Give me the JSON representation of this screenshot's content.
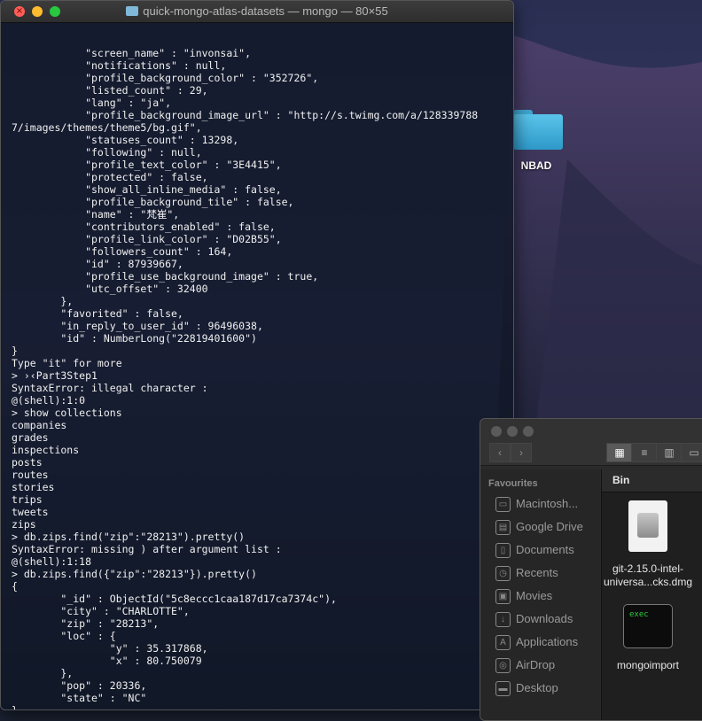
{
  "desktop": {
    "folder_label": "NBAD"
  },
  "terminal": {
    "title": "quick-mongo-atlas-datasets — mongo — 80×55",
    "lines": [
      "            \"screen_name\" : \"invonsai\",",
      "            \"notifications\" : null,",
      "            \"profile_background_color\" : \"352726\",",
      "            \"listed_count\" : 29,",
      "            \"lang\" : \"ja\",",
      "            \"profile_background_image_url\" : \"http://s.twimg.com/a/128339788",
      "7/images/themes/theme5/bg.gif\",",
      "            \"statuses_count\" : 13298,",
      "            \"following\" : null,",
      "            \"profile_text_color\" : \"3E4415\",",
      "            \"protected\" : false,",
      "            \"show_all_inline_media\" : false,",
      "            \"profile_background_tile\" : false,",
      "            \"name\" : \"梵崔\",",
      "            \"contributors_enabled\" : false,",
      "            \"profile_link_color\" : \"D02B55\",",
      "            \"followers_count\" : 164,",
      "            \"id\" : 87939667,",
      "            \"profile_use_background_image\" : true,",
      "            \"utc_offset\" : 32400",
      "        },",
      "        \"favorited\" : false,",
      "        \"in_reply_to_user_id\" : 96496038,",
      "        \"id\" : NumberLong(\"22819401600\")",
      "}",
      "Type \"it\" for more",
      "> ›‹Part3Step1",
      "SyntaxError: illegal character :",
      "@(shell):1:0",
      "> show collections",
      "companies",
      "grades",
      "inspections",
      "posts",
      "routes",
      "stories",
      "trips",
      "tweets",
      "zips",
      "> db.zips.find(\"zip\":\"28213\").pretty()",
      "SyntaxError: missing ) after argument list :",
      "@(shell):1:18",
      "> db.zips.find({\"zip\":\"28213\"}).pretty()",
      "{",
      "        \"_id\" : ObjectId(\"5c8eccc1caa187d17ca7374c\"),",
      "        \"city\" : \"CHARLOTTE\",",
      "        \"zip\" : \"28213\",",
      "        \"loc\" : {",
      "                \"y\" : 35.317868,",
      "                \"x\" : 80.750079",
      "        },",
      "        \"pop\" : 20336,",
      "        \"state\" : \"NC\"",
      "}"
    ],
    "prompt": "> "
  },
  "finder": {
    "sidebar_heading": "Favourites",
    "sidebar_items": [
      {
        "label": "Macintosh...",
        "icon": "harddisk-icon"
      },
      {
        "label": "Google Drive",
        "icon": "folder-icon"
      },
      {
        "label": "Documents",
        "icon": "document-icon"
      },
      {
        "label": "Recents",
        "icon": "clock-icon"
      },
      {
        "label": "Movies",
        "icon": "film-icon"
      },
      {
        "label": "Downloads",
        "icon": "download-icon"
      },
      {
        "label": "Applications",
        "icon": "applications-icon"
      },
      {
        "label": "AirDrop",
        "icon": "airdrop-icon"
      },
      {
        "label": "Desktop",
        "icon": "desktop-icon"
      }
    ],
    "path": "Bin",
    "files": [
      {
        "name_line1": "git-2.15.0-intel-",
        "name_line2": "universa...cks.dmg",
        "icon": "disk-image-icon"
      },
      {
        "name_line1": "mongoimport",
        "name_line2": "",
        "icon": "exec-icon",
        "icon_text": "exec"
      }
    ]
  }
}
